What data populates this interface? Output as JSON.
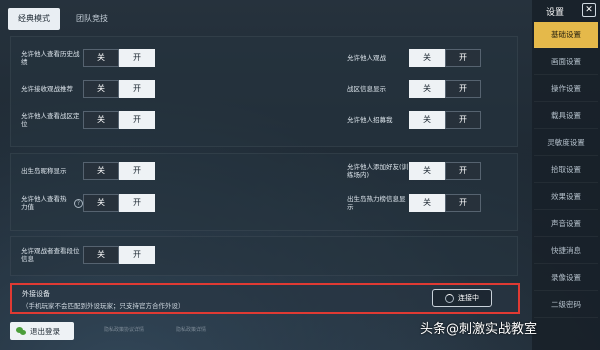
{
  "tabs": [
    {
      "label": "经典模式",
      "active": true
    },
    {
      "label": "团队竞技",
      "active": false
    }
  ],
  "toggle": {
    "off": "关",
    "on": "开"
  },
  "settings": {
    "s1": {
      "label": "允许他人查看历史战绩",
      "value": "off"
    },
    "s2": {
      "label": "允许他人观战",
      "value": "on"
    },
    "s3": {
      "label": "允许接收观战推荐",
      "value": "off"
    },
    "s4": {
      "label": "战区信息显示",
      "value": "on"
    },
    "s5": {
      "label": "允许他人查看战区定位",
      "value": "off"
    },
    "s6": {
      "label": "允许他人招募我",
      "value": "on"
    },
    "s7": {
      "label": "出生岛昵称显示",
      "value": "off"
    },
    "s8": {
      "label": "允许他人添加好友(训练场内)",
      "value": "on"
    },
    "s9": {
      "label": "允许他人查看热力值",
      "value": "off"
    },
    "s10": {
      "label": "出生岛热力榜信息显示",
      "value": "on"
    },
    "s11": {
      "label": "允许观战者查看段位信息",
      "value": "off"
    }
  },
  "external": {
    "title": "外接设备",
    "desc": "（手机玩家不会匹配到外设玩家；只支持官方合作外设）",
    "button": "连接中"
  },
  "logout": "退出登录",
  "footer": {
    "note1": "隐私政策协议详情",
    "note2": "隐私政策详情"
  },
  "sidebar": {
    "title": "设置",
    "close": "✕",
    "items": [
      "基础设置",
      "画面设置",
      "操作设置",
      "载具设置",
      "灵敏度设置",
      "拾取设置",
      "效果设置",
      "声音设置",
      "快捷消息",
      "录像设置",
      "二级密码"
    ]
  },
  "watermark": "头条@刺激实战教室"
}
